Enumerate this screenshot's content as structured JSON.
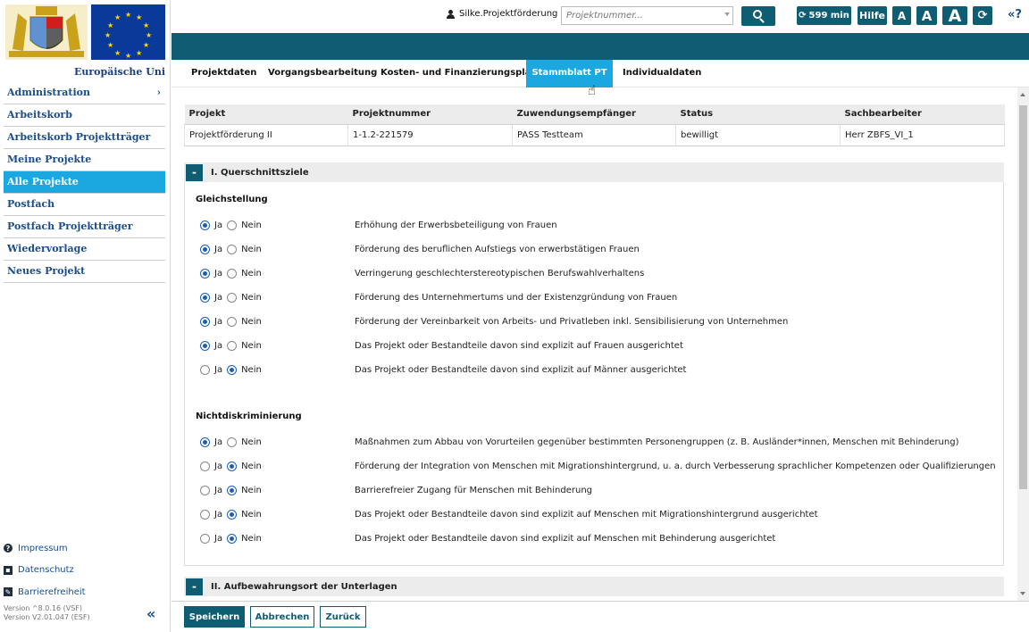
{
  "sidebar": {
    "eu_label": "Europäische Uni",
    "nav": [
      {
        "label": "Administration",
        "has_children": true
      },
      {
        "label": "Arbeitskorb"
      },
      {
        "label": "Arbeitskorb Projektträger"
      },
      {
        "label": "Meine Projekte"
      },
      {
        "label": "Alle Projekte",
        "active": true
      },
      {
        "label": "Postfach"
      },
      {
        "label": "Postfach Projektträger"
      },
      {
        "label": "Wiedervorlage"
      },
      {
        "label": "Neues Projekt"
      }
    ],
    "links": [
      {
        "label": "Impressum",
        "icon": "help-circle-icon"
      },
      {
        "label": "Datenschutz",
        "icon": "id-card-icon"
      },
      {
        "label": "Barrierefreiheit",
        "icon": "edit-icon"
      }
    ],
    "version_line1": "Version ^8.0.16 (VSF)",
    "version_line2": "Version V2.01.047 (ESF)",
    "nav_chevron": "›",
    "collapse_glyph": "«"
  },
  "header": {
    "user": "Silke.Projektförderung",
    "search_placeholder": "Projektnummer...",
    "timer": "599 min",
    "refresh_glyph": "⟳",
    "hilfe": "Hilfe",
    "font_small": "A",
    "font_medium": "A",
    "font_large": "A",
    "help_links": "«?"
  },
  "tabs": [
    {
      "label": "Projektdaten"
    },
    {
      "label": "Vorgangsbearbeitung"
    },
    {
      "label": "Kosten- und Finanzierungsplan"
    },
    {
      "label": "Stammblatt PT",
      "active": true
    },
    {
      "label": "Individualdaten"
    }
  ],
  "project_table": {
    "headers": [
      "Projekt",
      "Projektnummer",
      "Zuwendungsempfänger",
      "Status",
      "Sachbearbeiter"
    ],
    "row": [
      "Projektförderung II",
      "1-1.2-221579",
      "PASS Testteam",
      "bewilligt",
      "Herr ZBFS_VI_1"
    ]
  },
  "sections": [
    {
      "toggle": "-",
      "title": "I. Querschnittsziele"
    },
    {
      "toggle": "-",
      "title": "II. Aufbewahrungsort der Unterlagen"
    }
  ],
  "radio_labels": {
    "yes": "Ja",
    "no": "Nein"
  },
  "groups": [
    {
      "title": "Gleichstellung",
      "items": [
        {
          "text": "Erhöhung der Erwerbsbeteiligung von Frauen",
          "answer": "ja"
        },
        {
          "text": "Förderung des beruflichen Aufstiegs von erwerbstätigen Frauen",
          "answer": "ja"
        },
        {
          "text": "Verringerung geschlechterstereotypischen Berufswahlverhaltens",
          "answer": "ja"
        },
        {
          "text": "Förderung des Unternehmertums und der Existenzgründung von Frauen",
          "answer": "ja"
        },
        {
          "text": "Förderung der Vereinbarkeit von Arbeits- und Privatleben inkl. Sensibilisierung von Unternehmen",
          "answer": "ja"
        },
        {
          "text": "Das Projekt oder Bestandteile davon sind explizit auf Frauen ausgerichtet",
          "answer": "ja"
        },
        {
          "text": "Das Projekt oder Bestandteile davon sind explizit auf Männer ausgerichtet",
          "answer": "nein"
        }
      ]
    },
    {
      "title": "Nichtdiskriminierung",
      "items": [
        {
          "text": "Maßnahmen zum Abbau von Vorurteilen gegenüber bestimmten Personengruppen (z. B. Ausländer*innen, Menschen mit Behinderung)",
          "answer": "ja"
        },
        {
          "text": "Förderung der Integration von Menschen mit Migrationshintergrund, u. a. durch Verbesserung sprachlicher Kompetenzen oder Qualifizierungen",
          "answer": "nein"
        },
        {
          "text": "Barrierefreier Zugang für Menschen mit Behinderung",
          "answer": "nein"
        },
        {
          "text": "Das Projekt oder Bestandteile davon sind explizit auf Menschen mit Migrationshintergrund ausgerichtet",
          "answer": "nein"
        },
        {
          "text": "Das Projekt oder Bestandteile davon sind explizit auf Menschen mit Behinderung ausgerichtet",
          "answer": "nein"
        }
      ]
    }
  ],
  "footer": {
    "save": "Speichern",
    "cancel": "Abbrechen",
    "back": "Zurück"
  },
  "colors": {
    "teal": "#0e5d73",
    "active_blue": "#1ba8e0",
    "nav_text": "#1a4d8a"
  }
}
